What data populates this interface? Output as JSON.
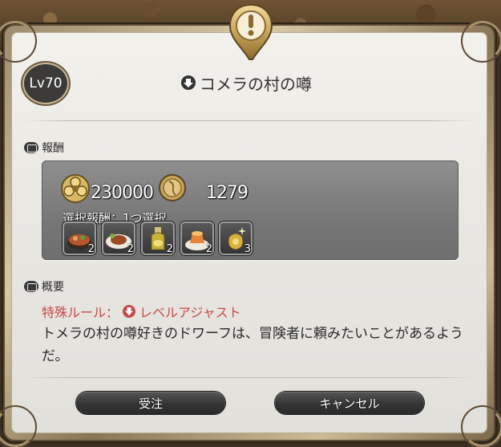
{
  "level": {
    "label": "Lv70"
  },
  "quest": {
    "title": "コメラの村の噂",
    "icon": "down-arrow-circle-icon"
  },
  "rewards": {
    "heading": "報酬",
    "gil": "230000",
    "seals": "1279",
    "choice_label": "選択報酬：1つ選択",
    "items": [
      {
        "name": "dish-stew-icon",
        "qty": "2"
      },
      {
        "name": "dish-steak-icon",
        "qty": "2"
      },
      {
        "name": "oil-bottle-icon",
        "qty": "2"
      },
      {
        "name": "dish-dessert-icon",
        "qty": "2"
      },
      {
        "name": "gold-pouch-icon",
        "qty": "3"
      }
    ]
  },
  "summary": {
    "heading": "概要",
    "special_rule": "特殊ルール：",
    "rule_name": "レベルアジャスト",
    "text": "トメラの村の噂好きのドワーフは、冒険者に頼みたいことがあるようだ。"
  },
  "buttons": {
    "accept": "受注",
    "cancel": "キャンセル"
  },
  "colors": {
    "accent_red": "#c64a4a",
    "gold": "#c9a55a",
    "panel": "#eeece7"
  }
}
